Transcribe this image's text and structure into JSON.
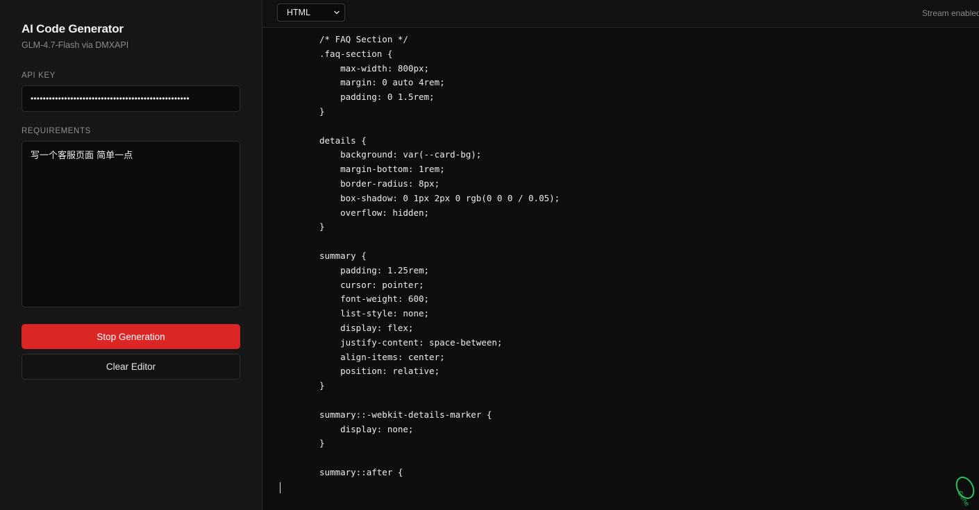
{
  "sidebar": {
    "title": "AI Code Generator",
    "subtitle": "GLM-4.7-Flash via DMXAPI",
    "api_key_label": "API KEY",
    "api_key_value": "••••••••••••••••••••••••••••••••••••••••••••••••••••",
    "requirements_label": "REQUIREMENTS",
    "requirements_value": "写一个客服页面 简单一点",
    "stop_button": "Stop Generation",
    "clear_button": "Clear Editor"
  },
  "topbar": {
    "language_selected": "HTML",
    "status": "Stream enabled"
  },
  "editor": {
    "code": "/* FAQ Section */\n.faq-section {\n    max-width: 800px;\n    margin: 0 auto 4rem;\n    padding: 0 1.5rem;\n}\n\ndetails {\n    background: var(--card-bg);\n    margin-bottom: 1rem;\n    border-radius: 8px;\n    box-shadow: 0 1px 2px 0 rgb(0 0 0 / 0.05);\n    overflow: hidden;\n}\n\nsummary {\n    padding: 1.25rem;\n    cursor: pointer;\n    font-weight: 600;\n    list-style: none;\n    display: flex;\n    justify-content: space-between;\n    align-items: center;\n    position: relative;\n}\n\nsummary::-webkit-details-marker {\n    display: none;\n}\n\nsummary::after {",
    "badge_text": "Gene"
  },
  "colors": {
    "stop_button": "#dc2626",
    "sidebar_bg": "#171717",
    "editor_bg": "#0e0e0e",
    "badge": "#22c55e"
  }
}
